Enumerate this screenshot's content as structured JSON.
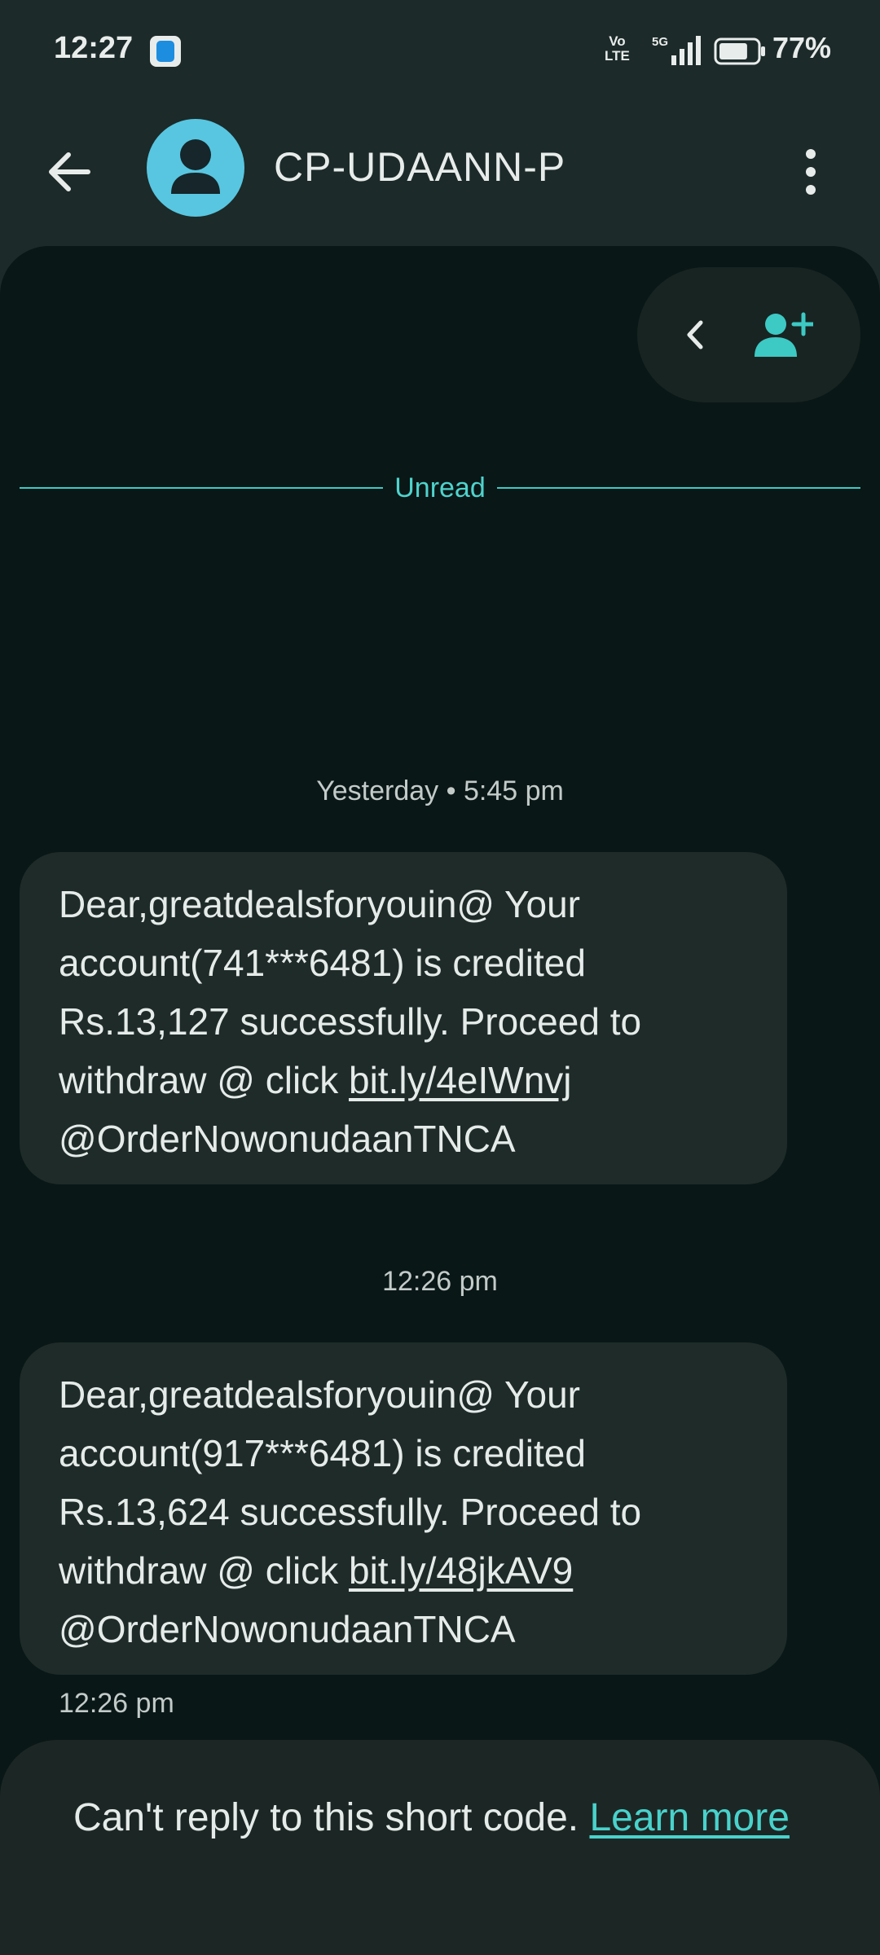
{
  "status_bar": {
    "time": "12:27",
    "volte_top": "Vo",
    "volte_bottom": "LTE",
    "network": "5G",
    "battery": "77%",
    "battery_level": 0.77
  },
  "header": {
    "contact_name": "CP-UDAANN-P"
  },
  "divider": {
    "label": "Unread"
  },
  "messages": [
    {
      "timestamp": "Yesterday • 5:45 pm",
      "text_before": "Dear,greatdealsforyouin@ Your account(741***6481) is credited Rs.13,127 successfully. Proceed to withdraw @ click ",
      "link": "bit.ly/4eIWnvj",
      "text_after": " @OrderNowonudaanTNCA"
    },
    {
      "timestamp": "12:26 pm",
      "text_before": "Dear,greatdealsforyouin@ Your account(917***6481) is credited Rs.13,624 successfully. Proceed to withdraw @ click ",
      "link": "bit.ly/48jkAV9",
      "text_after": " @OrderNowonudaanTNCA",
      "footer_time": "12:26 pm"
    }
  ],
  "footer": {
    "text": "Can't reply to this short code. ",
    "link": "Learn more"
  },
  "colors": {
    "accent": "#3dc9c4",
    "avatar": "#58c6e0",
    "background": "#091716",
    "bubble": "#1e2b29"
  },
  "icons": {
    "back": "arrow-left-icon",
    "more": "more-vertical-icon",
    "collapse": "chevron-left-icon",
    "add_contact": "person-add-icon"
  }
}
